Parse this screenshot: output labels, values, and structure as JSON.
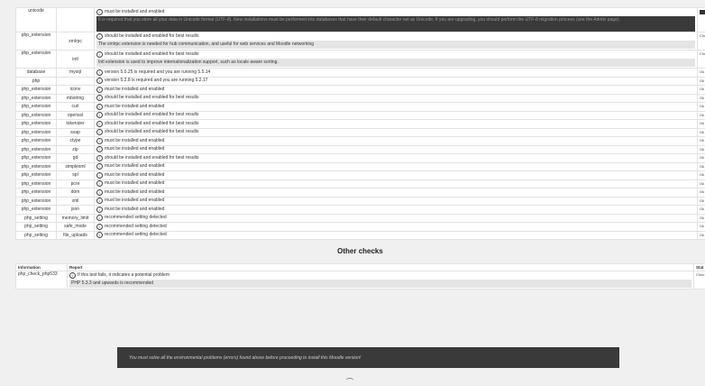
{
  "env_rows": [
    {
      "type": "unicode",
      "name": "",
      "msg": "must be installed and enabled",
      "note": "It is required that you store all your data in Unicode format (UTF-8). New installations must be performed into databases that have their default character set as Unicode. If you are upgrading, you should perform the UTF-8 migration process (see the Admin page).",
      "status": "",
      "error": true
    },
    {
      "type": "php_extension",
      "name": "xmlrpc",
      "msg": "should be installed and enabled for best results",
      "note": "The xmlrpc extension is needed for hub communication, and useful for web services and Moodle networking",
      "status": "Chec"
    },
    {
      "type": "php_extension",
      "name": "intl",
      "msg": "should be installed and enabled for best results",
      "note": "Intl extension is used to improve internationalization support, such as locale aware sorting.",
      "status": "Chec"
    },
    {
      "type": "database",
      "name": "mysql",
      "msg": "version 5.0.25 is required and you are running 5.5.14",
      "status": "Ok"
    },
    {
      "type": "php",
      "name": "",
      "msg": "version 5.2.8 is required and you are running 5.2.17",
      "status": "Ok"
    },
    {
      "type": "php_extension",
      "name": "iconv",
      "msg": "must be installed and enabled",
      "status": "Ok"
    },
    {
      "type": "php_extension",
      "name": "mbstring",
      "msg": "should be installed and enabled for best results",
      "status": "Ok"
    },
    {
      "type": "php_extension",
      "name": "curl",
      "msg": "must be installed and enabled",
      "status": "Ok"
    },
    {
      "type": "php_extension",
      "name": "openssl",
      "msg": "should be installed and enabled for best results",
      "status": "Ok"
    },
    {
      "type": "php_extension",
      "name": "tokenizer",
      "msg": "should be installed and enabled for best results",
      "status": "Ok"
    },
    {
      "type": "php_extension",
      "name": "soap",
      "msg": "should be installed and enabled for best results",
      "status": "Ok"
    },
    {
      "type": "php_extension",
      "name": "ctype",
      "msg": "must be installed and enabled",
      "status": "Ok"
    },
    {
      "type": "php_extension",
      "name": "zip",
      "msg": "must be installed and enabled",
      "status": "Ok"
    },
    {
      "type": "php_extension",
      "name": "gd",
      "msg": "should be installed and enabled for best results",
      "status": "Ok"
    },
    {
      "type": "php_extension",
      "name": "simplexml",
      "msg": "must be installed and enabled",
      "status": "Ok"
    },
    {
      "type": "php_extension",
      "name": "spl",
      "msg": "must be installed and enabled",
      "status": "Ok"
    },
    {
      "type": "php_extension",
      "name": "pcre",
      "msg": "must be installed and enabled",
      "status": "Ok"
    },
    {
      "type": "php_extension",
      "name": "dom",
      "msg": "must be installed and enabled",
      "status": "Ok"
    },
    {
      "type": "php_extension",
      "name": "xml",
      "msg": "must be installed and enabled",
      "status": "Ok"
    },
    {
      "type": "php_extension",
      "name": "json",
      "msg": "must be installed and enabled",
      "status": "Ok"
    },
    {
      "type": "php_setting",
      "name": "memory_limit",
      "msg": "recommended setting detected",
      "status": "Ok"
    },
    {
      "type": "php_setting",
      "name": "safe_mode",
      "msg": "recommended setting detected",
      "status": "Ok"
    },
    {
      "type": "php_setting",
      "name": "file_uploads",
      "msg": "recommended setting detected",
      "status": "Ok"
    }
  ],
  "other_checks": {
    "title": "Other checks",
    "headers": {
      "information": "Information",
      "report": "Report",
      "status": "Stat"
    },
    "rows": [
      {
        "information": "php_check_php533",
        "report": "If this test fails, it indicates a potential problem",
        "note": "PHP 5.3.3 and upwards is recommended",
        "status": "Chec"
      }
    ]
  },
  "banner": "You must solve all the environmental problems (errors) found above before proceeding to install this Moodle version!",
  "info_glyph": "i",
  "continue_glyph": "⌒",
  "colors": {
    "page_bg": "#f0f0f0",
    "banner_bg": "#3a3a3a",
    "note_bg": "#e4e4e4"
  }
}
